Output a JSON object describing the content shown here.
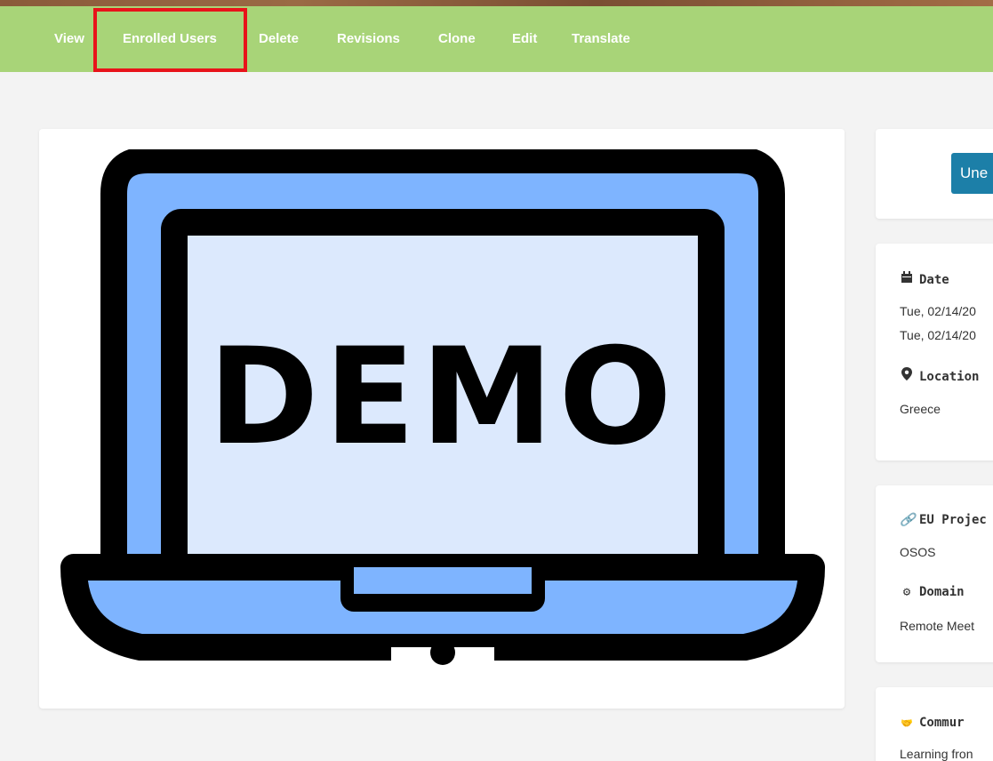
{
  "tabs": [
    {
      "label": "View"
    },
    {
      "label": "Enrolled Users"
    },
    {
      "label": "Delete"
    },
    {
      "label": "Revisions"
    },
    {
      "label": "Clone"
    },
    {
      "label": "Edit"
    },
    {
      "label": "Translate"
    }
  ],
  "image": {
    "text": "DEMO",
    "colors": {
      "screen_frame": "#7eb4ff",
      "screen": "#dce9fd",
      "outline": "#000000"
    }
  },
  "sidebar": {
    "action_button_label": "Une",
    "date": {
      "label": "Date",
      "icon": "calendar-icon",
      "start": "Tue, 02/14/20",
      "end": "Tue, 02/14/20"
    },
    "location": {
      "label": "Location",
      "icon": "map-marker-icon",
      "value": "Greece"
    },
    "eu_project": {
      "label": "EU Projec",
      "icon": "link-icon",
      "value": "OSOS"
    },
    "domain": {
      "label": "Domain",
      "icon": "cogs-icon",
      "value": "Remote Meet"
    },
    "community": {
      "label": "Commur",
      "icon": "handshake-icon",
      "value": "Learning fron"
    }
  },
  "colors": {
    "tab_bar": "#a8d478",
    "highlight": "#e8131a",
    "button": "#1c7fa8",
    "page_bg": "#f3f3f3"
  }
}
